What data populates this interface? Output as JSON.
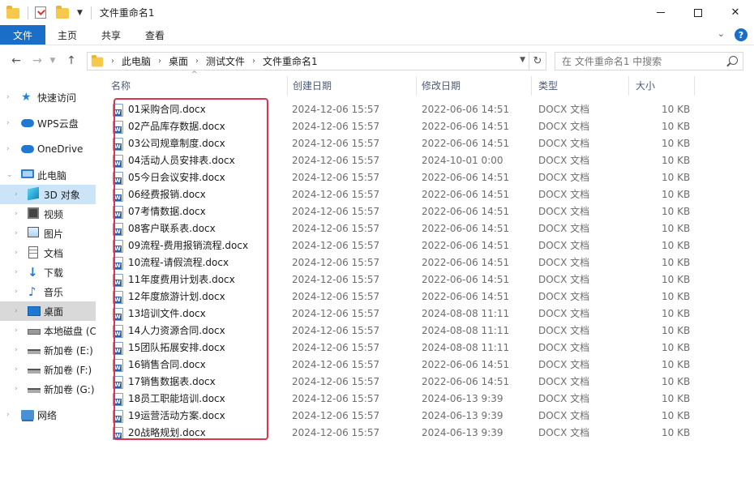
{
  "window": {
    "title": "文件重命名1"
  },
  "ribbon": {
    "tabs": [
      "文件",
      "主页",
      "共享",
      "查看"
    ]
  },
  "address": {
    "crumbs": [
      "此电脑",
      "桌面",
      "测试文件",
      "文件重命名1"
    ],
    "search_placeholder": "在 文件重命名1 中搜索"
  },
  "sidebar": {
    "items": [
      {
        "label": "快速访问",
        "icon": "star-icon"
      },
      {
        "label": "WPS云盘",
        "icon": "cloud-icon"
      },
      {
        "label": "OneDrive",
        "icon": "cloud-icon"
      },
      {
        "label": "此电脑",
        "icon": "computer-icon"
      },
      {
        "label": "3D 对象",
        "icon": "cube-icon"
      },
      {
        "label": "视频",
        "icon": "video-icon"
      },
      {
        "label": "图片",
        "icon": "picture-icon"
      },
      {
        "label": "文档",
        "icon": "document-icon"
      },
      {
        "label": "下载",
        "icon": "download-icon"
      },
      {
        "label": "音乐",
        "icon": "music-icon"
      },
      {
        "label": "桌面",
        "icon": "desktop-icon"
      },
      {
        "label": "本地磁盘 (C",
        "icon": "drive-icon"
      },
      {
        "label": "新加卷 (E:)",
        "icon": "drive-icon"
      },
      {
        "label": "新加卷 (F:)",
        "icon": "drive-icon"
      },
      {
        "label": "新加卷 (G:)",
        "icon": "drive-icon"
      },
      {
        "label": "网络",
        "icon": "network-icon"
      }
    ]
  },
  "columns": {
    "name": "名称",
    "created": "创建日期",
    "modified": "修改日期",
    "type": "类型",
    "size": "大小"
  },
  "files": [
    {
      "name": "01采购合同.docx",
      "created": "2024-12-06 15:57",
      "modified": "2022-06-06 14:51",
      "type": "DOCX 文档",
      "size": "10 KB"
    },
    {
      "name": "02产品库存数据.docx",
      "created": "2024-12-06 15:57",
      "modified": "2022-06-06 14:51",
      "type": "DOCX 文档",
      "size": "10 KB"
    },
    {
      "name": "03公司规章制度.docx",
      "created": "2024-12-06 15:57",
      "modified": "2022-06-06 14:51",
      "type": "DOCX 文档",
      "size": "10 KB"
    },
    {
      "name": "04活动人员安排表.docx",
      "created": "2024-12-06 15:57",
      "modified": "2024-10-01 0:00",
      "type": "DOCX 文档",
      "size": "10 KB"
    },
    {
      "name": "05今日会议安排.docx",
      "created": "2024-12-06 15:57",
      "modified": "2022-06-06 14:51",
      "type": "DOCX 文档",
      "size": "10 KB"
    },
    {
      "name": "06经费报销.docx",
      "created": "2024-12-06 15:57",
      "modified": "2022-06-06 14:51",
      "type": "DOCX 文档",
      "size": "10 KB"
    },
    {
      "name": "07考情数据.docx",
      "created": "2024-12-06 15:57",
      "modified": "2022-06-06 14:51",
      "type": "DOCX 文档",
      "size": "10 KB"
    },
    {
      "name": "08客户联系表.docx",
      "created": "2024-12-06 15:57",
      "modified": "2022-06-06 14:51",
      "type": "DOCX 文档",
      "size": "10 KB"
    },
    {
      "name": "09流程-费用报销流程.docx",
      "created": "2024-12-06 15:57",
      "modified": "2022-06-06 14:51",
      "type": "DOCX 文档",
      "size": "10 KB"
    },
    {
      "name": "10流程-请假流程.docx",
      "created": "2024-12-06 15:57",
      "modified": "2022-06-06 14:51",
      "type": "DOCX 文档",
      "size": "10 KB"
    },
    {
      "name": "11年度费用计划表.docx",
      "created": "2024-12-06 15:57",
      "modified": "2022-06-06 14:51",
      "type": "DOCX 文档",
      "size": "10 KB"
    },
    {
      "name": "12年度旅游计划.docx",
      "created": "2024-12-06 15:57",
      "modified": "2022-06-06 14:51",
      "type": "DOCX 文档",
      "size": "10 KB"
    },
    {
      "name": "13培训文件.docx",
      "created": "2024-12-06 15:57",
      "modified": "2024-08-08 11:11",
      "type": "DOCX 文档",
      "size": "10 KB"
    },
    {
      "name": "14人力资源合同.docx",
      "created": "2024-12-06 15:57",
      "modified": "2024-08-08 11:11",
      "type": "DOCX 文档",
      "size": "10 KB"
    },
    {
      "name": "15团队拓展安排.docx",
      "created": "2024-12-06 15:57",
      "modified": "2024-08-08 11:11",
      "type": "DOCX 文档",
      "size": "10 KB"
    },
    {
      "name": "16销售合同.docx",
      "created": "2024-12-06 15:57",
      "modified": "2022-06-06 14:51",
      "type": "DOCX 文档",
      "size": "10 KB"
    },
    {
      "name": "17销售数据表.docx",
      "created": "2024-12-06 15:57",
      "modified": "2022-06-06 14:51",
      "type": "DOCX 文档",
      "size": "10 KB"
    },
    {
      "name": "18员工职能培训.docx",
      "created": "2024-12-06 15:57",
      "modified": "2024-06-13 9:39",
      "type": "DOCX 文档",
      "size": "10 KB"
    },
    {
      "name": "19运营活动方案.docx",
      "created": "2024-12-06 15:57",
      "modified": "2024-06-13 9:39",
      "type": "DOCX 文档",
      "size": "10 KB"
    },
    {
      "name": "20战略规划.docx",
      "created": "2024-12-06 15:57",
      "modified": "2024-06-13 9:39",
      "type": "DOCX 文档",
      "size": "10 KB"
    }
  ]
}
